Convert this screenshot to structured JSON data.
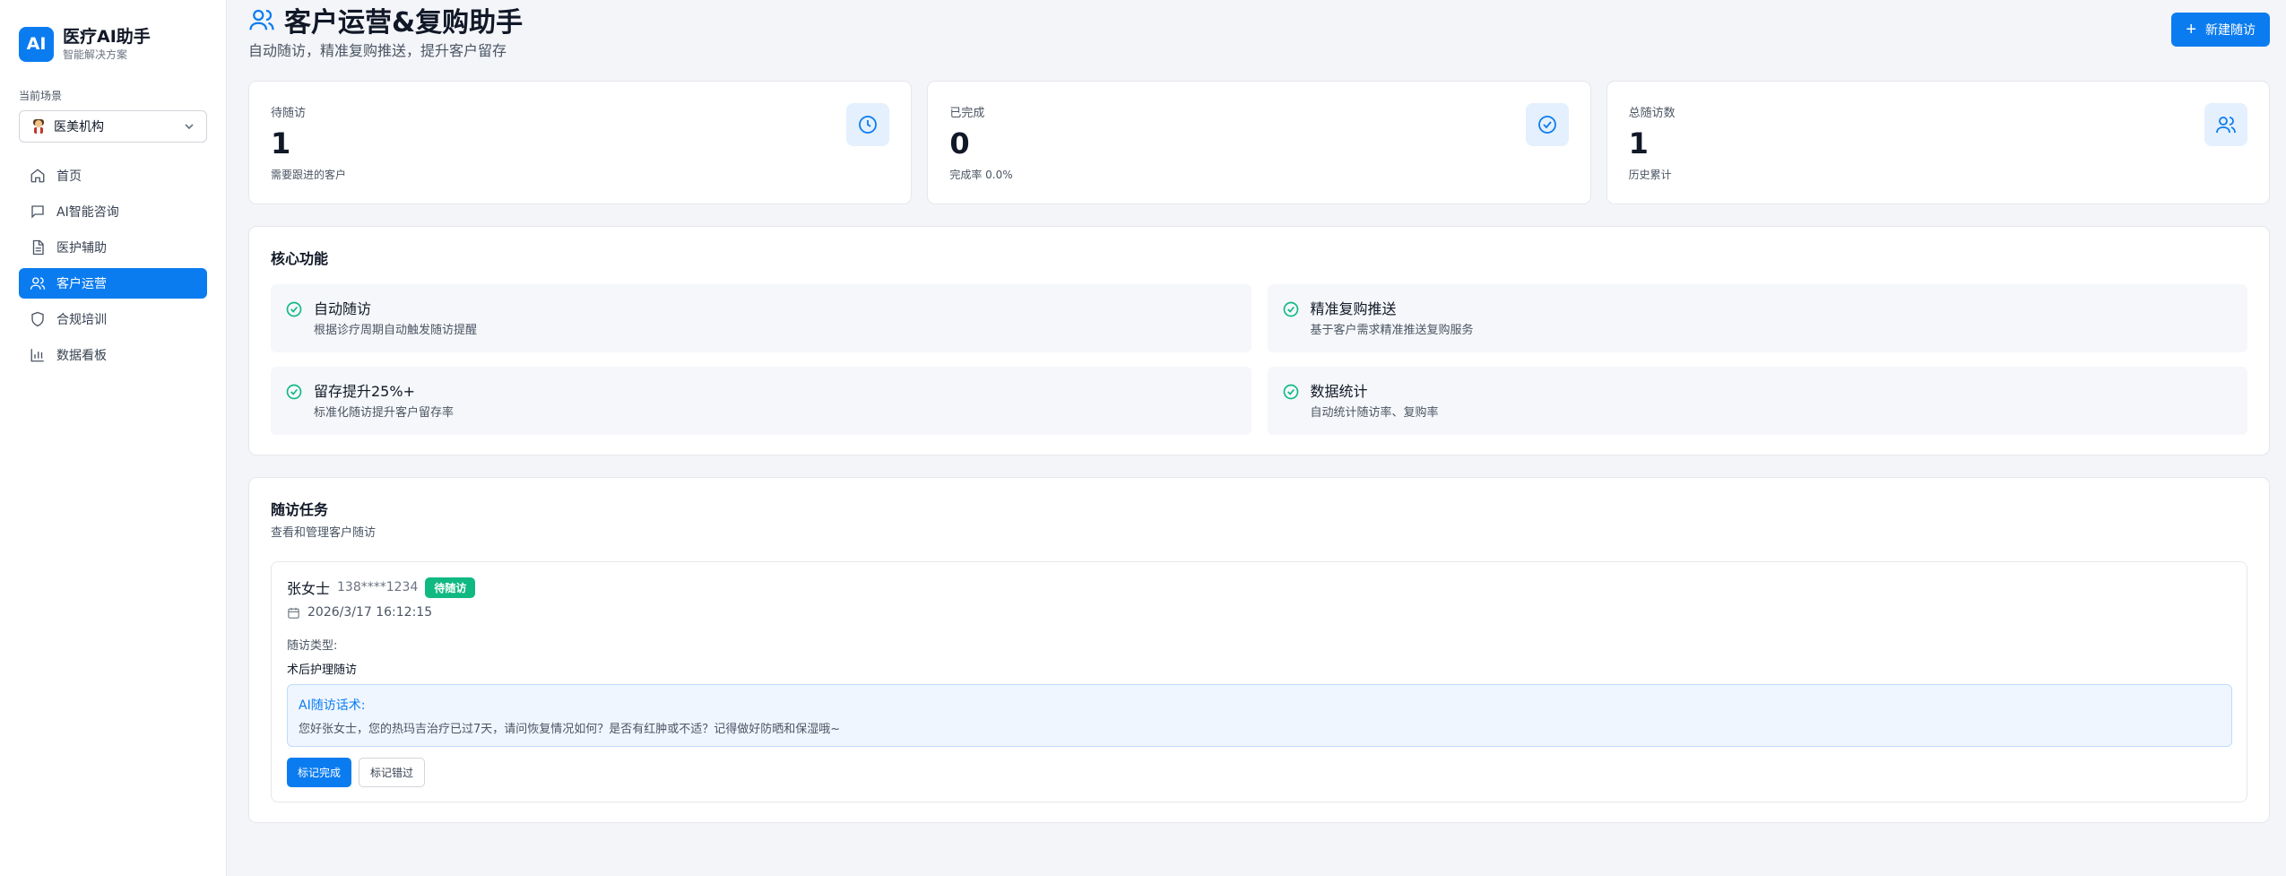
{
  "brand": {
    "logo": "AI",
    "title": "医疗AI助手",
    "subtitle": "智能解决方案"
  },
  "scene": {
    "label": "当前场景",
    "selected": "医美机构",
    "emoji_icon": "person-emoji-icon"
  },
  "nav": [
    {
      "label": "首页",
      "icon": "home-icon",
      "active": false
    },
    {
      "label": "AI智能咨询",
      "icon": "chat-icon",
      "active": false
    },
    {
      "label": "医护辅助",
      "icon": "document-icon",
      "active": false
    },
    {
      "label": "客户运营",
      "icon": "users-icon",
      "active": true
    },
    {
      "label": "合规培训",
      "icon": "shield-icon",
      "active": false
    },
    {
      "label": "数据看板",
      "icon": "bar-chart-icon",
      "active": false
    }
  ],
  "header": {
    "title": "客户运营&复购助手",
    "subtitle": "自动随访，精准复购推送，提升客户留存",
    "new_button": "新建随访"
  },
  "stats": [
    {
      "label": "待随访",
      "value": "1",
      "note": "需要跟进的客户",
      "icon": "clock-icon"
    },
    {
      "label": "已完成",
      "value": "0",
      "note": "完成率 0.0%",
      "icon": "check-circle-icon"
    },
    {
      "label": "总随访数",
      "value": "1",
      "note": "历史累计",
      "icon": "users-icon"
    }
  ],
  "features": {
    "title": "核心功能",
    "items": [
      {
        "title": "自动随访",
        "desc": "根据诊疗周期自动触发随访提醒"
      },
      {
        "title": "精准复购推送",
        "desc": "基于客户需求精准推送复购服务"
      },
      {
        "title": "留存提升25%+",
        "desc": "标准化随访提升客户留存率"
      },
      {
        "title": "数据统计",
        "desc": "自动统计随访率、复购率"
      }
    ]
  },
  "tasks": {
    "title": "随访任务",
    "subtitle": "查看和管理客户随访",
    "items": [
      {
        "name": "张女士",
        "phone": "138****1234",
        "status": "待随访",
        "time": "2026/3/17 16:12:15",
        "type_label": "随访类型:",
        "type": "术后护理随访",
        "ai_title": "AI随访话术:",
        "ai_text": "您好张女士，您的热玛吉治疗已过7天，请问恢复情况如何？是否有红肿或不适？记得做好防晒和保湿哦~",
        "complete_button": "标记完成",
        "miss_button": "标记错过"
      }
    ]
  },
  "colors": {
    "accent": "#0b7cf0",
    "success": "#10b981",
    "icon_bg": "#e4f0fd"
  }
}
